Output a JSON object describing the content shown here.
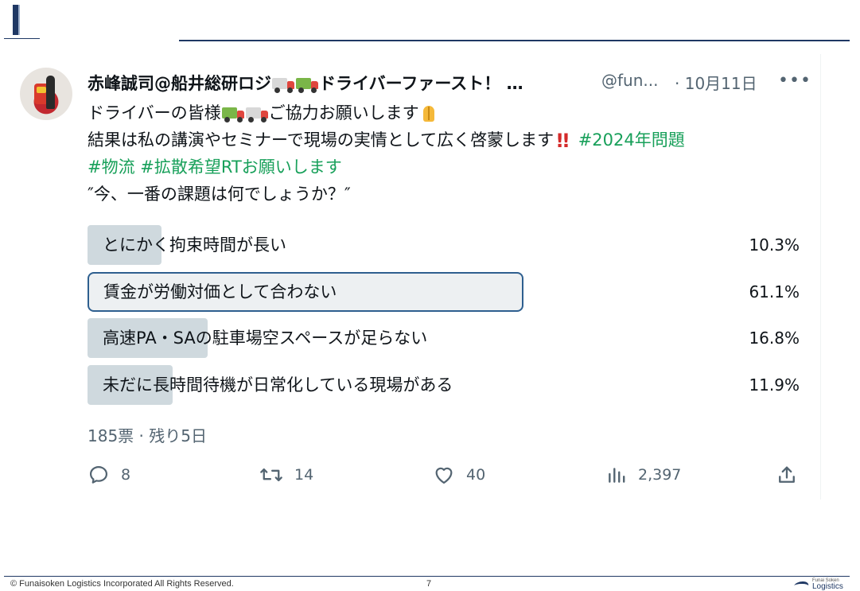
{
  "tweet": {
    "display_name_part1": "赤峰誠司@船井総研ロジ",
    "display_name_part2": "ドライバーファースト！ …",
    "handle": "@fun...",
    "date": "· 10月11日",
    "more": "•••",
    "text": {
      "line1_a": "ドライバーの皆様",
      "line1_b": "ご協力お願いします",
      "line2_a": "結果は私の講演やセミナーで現場の実情として広く啓蒙します",
      "line2_hashtag": "#2024年問題",
      "line3_hashtag1": "#物流",
      "line3_hashtag2": "#拡散希望RTお願いします",
      "line4": "″今、一番の課題は何でしょうか？″"
    }
  },
  "poll": {
    "options": [
      {
        "label": "とにかく拘束時間が長い",
        "percent": "10.3%",
        "fraction": 0.103
      },
      {
        "label": "賃金が労働対価として合わない",
        "percent": "61.1%",
        "fraction": 0.611
      },
      {
        "label": "高速PA・SAの駐車場空スペースが足らない",
        "percent": "16.8%",
        "fraction": 0.168
      },
      {
        "label": "未だに長時間待機が日常化している現場がある",
        "percent": "11.9%",
        "fraction": 0.119
      }
    ],
    "meta": "185票 · 残り5日"
  },
  "actions": {
    "replies": "8",
    "retweets": "14",
    "likes": "40",
    "views": "2,397"
  },
  "footer": {
    "copyright": "© Funaisoken Logistics Incorporated All Rights Reserved.",
    "page": "7",
    "logo_line1": "Funai Soken",
    "logo_line2": "Logistics"
  },
  "colors": {
    "accent": "#1f3864",
    "hashtag": "#18a05a",
    "poll_bar": "#cfd9de",
    "poll_winner_border": "#2e5f8f",
    "muted_text": "#536471"
  }
}
